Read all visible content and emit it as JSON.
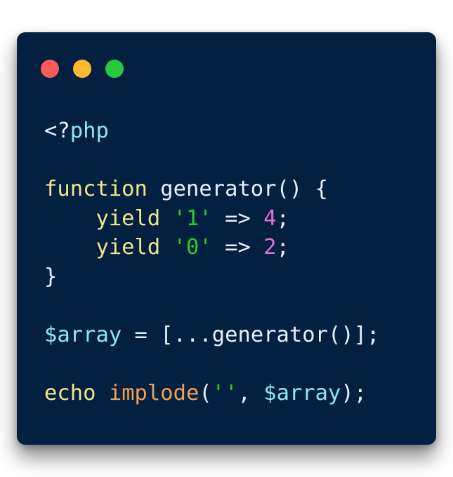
{
  "colors": {
    "page_background": "#ffffff",
    "window_background": "#042040",
    "dot_red": "#fb5b58",
    "dot_yellow": "#fdb82c",
    "dot_green": "#27c93f",
    "plain": "#e8f0f8",
    "keyword": "#f0e68c",
    "string": "#2ecc2e",
    "number": "#e96cd3",
    "variable": "#8ee8f0",
    "func_call": "#f0a058"
  },
  "window_controls": [
    {
      "name": "close-dot",
      "color_key": "dot_red"
    },
    {
      "name": "minimize-dot",
      "color_key": "dot_yellow"
    },
    {
      "name": "maximize-dot",
      "color_key": "dot_green"
    }
  ],
  "code_lines": [
    [
      {
        "t": "<?",
        "c": "plain"
      },
      {
        "t": "php",
        "c": "variable"
      }
    ],
    [],
    [
      {
        "t": "function",
        "c": "keyword"
      },
      {
        "t": " generator() {",
        "c": "plain"
      }
    ],
    [
      {
        "t": "    ",
        "c": "plain"
      },
      {
        "t": "yield",
        "c": "keyword"
      },
      {
        "t": " ",
        "c": "plain"
      },
      {
        "t": "'1'",
        "c": "string"
      },
      {
        "t": " => ",
        "c": "plain"
      },
      {
        "t": "4",
        "c": "number"
      },
      {
        "t": ";",
        "c": "plain"
      }
    ],
    [
      {
        "t": "    ",
        "c": "plain"
      },
      {
        "t": "yield",
        "c": "keyword"
      },
      {
        "t": " ",
        "c": "plain"
      },
      {
        "t": "'0'",
        "c": "string"
      },
      {
        "t": " => ",
        "c": "plain"
      },
      {
        "t": "2",
        "c": "number"
      },
      {
        "t": ";",
        "c": "plain"
      }
    ],
    [
      {
        "t": "}",
        "c": "plain"
      }
    ],
    [],
    [
      {
        "t": "$array",
        "c": "variable"
      },
      {
        "t": " = [...generator()];",
        "c": "plain"
      }
    ],
    [],
    [
      {
        "t": "echo",
        "c": "keyword"
      },
      {
        "t": " ",
        "c": "plain"
      },
      {
        "t": "implode",
        "c": "func_call"
      },
      {
        "t": "(",
        "c": "plain"
      },
      {
        "t": "''",
        "c": "string"
      },
      {
        "t": ", ",
        "c": "plain"
      },
      {
        "t": "$array",
        "c": "variable"
      },
      {
        "t": ");",
        "c": "plain"
      }
    ]
  ]
}
